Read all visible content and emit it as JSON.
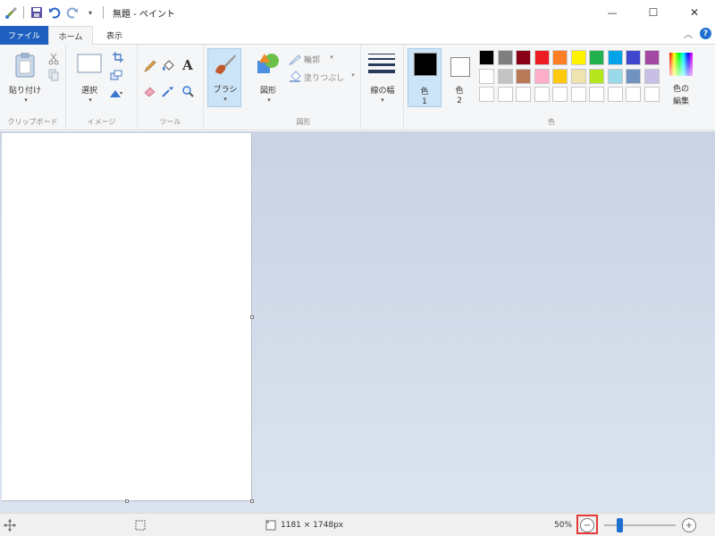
{
  "window": {
    "title": "無題 - ペイント",
    "qat_more": "▾",
    "minimize": "—",
    "maximize": "☐",
    "close": "✕"
  },
  "tabs": {
    "file": "ファイル",
    "home": "ホーム",
    "view": "表示",
    "collapse": "︿",
    "help": "?"
  },
  "ribbon": {
    "clipboard": {
      "paste": "貼り付け",
      "label": "クリップボード"
    },
    "image": {
      "select": "選択",
      "label": "イメージ"
    },
    "tools": {
      "label": "ツール"
    },
    "brushes": {
      "label": "ブラシ"
    },
    "shapes": {
      "shapes": "図形",
      "outline": "輪郭",
      "fill": "塗りつぶし",
      "label": "図形"
    },
    "size": {
      "label": "線の幅"
    },
    "colors": {
      "color1": "色",
      "color1_num": "1",
      "color2": "色",
      "color2_num": "2",
      "edit": "色の",
      "edit2": "編集",
      "label": "色",
      "primary_color": "#000000",
      "secondary_color": "#ffffff",
      "palette_row1": [
        "#000000",
        "#7f7f7f",
        "#880015",
        "#ed1c24",
        "#ff7f27",
        "#fff200",
        "#22b14c",
        "#00a2e8",
        "#3f48cc",
        "#a349a4"
      ],
      "palette_row2": [
        "#ffffff",
        "#c3c3c3",
        "#b97a57",
        "#ffaec9",
        "#ffc90e",
        "#efe4b0",
        "#b5e61d",
        "#99d9ea",
        "#7092be",
        "#c8bfe7"
      ],
      "palette_row3": [
        "#ffffff",
        "#ffffff",
        "#ffffff",
        "#ffffff",
        "#ffffff",
        "#ffffff",
        "#ffffff",
        "#ffffff",
        "#ffffff",
        "#ffffff"
      ]
    }
  },
  "status": {
    "dimensions": "1181 × 1748px",
    "zoom": "50%",
    "zoom_out": "−",
    "zoom_in": "+"
  }
}
